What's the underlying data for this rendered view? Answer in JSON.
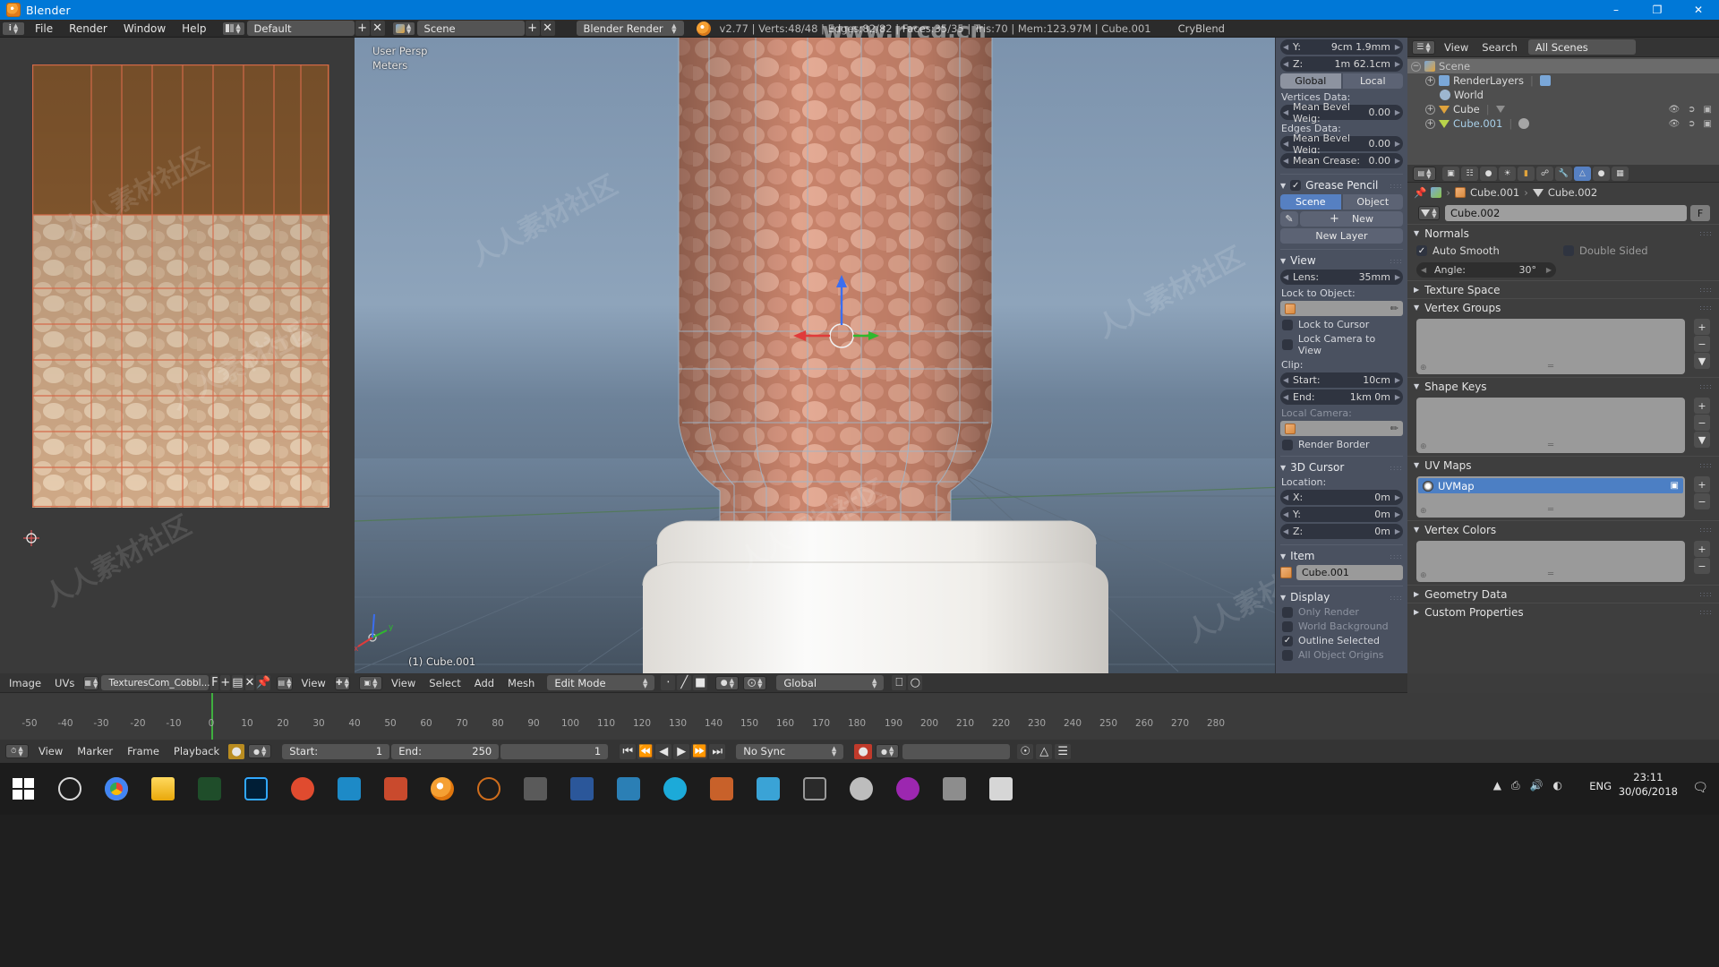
{
  "window": {
    "title": "Blender",
    "app_icon": "blender-logo-icon",
    "minimize": "–",
    "maximize": "❐",
    "close": "✕"
  },
  "topbar": {
    "editor_type_icon": "info-editor-icon",
    "menus": [
      "File",
      "Render",
      "Window",
      "Help"
    ],
    "screen_layout_icon": "screen-layout-icon",
    "screen_layout": "Default",
    "add_screen": "+",
    "delete_screen": "✕",
    "scene_icon": "scene-icon",
    "scene": "Scene",
    "add_scene": "+",
    "delete_scene": "✕",
    "render_engine": "Blender Render",
    "blender_icon": "blender-mark-icon",
    "stats": "v2.77 | Verts:48/48 | Edges:82/82 | Faces:35/35 | Tris:70 | Mem:123.97M | Cube.001",
    "addon": "CryBlend"
  },
  "uv_editor": {
    "header": {
      "editor_type_icon": "uv-image-editor-icon",
      "menus": [
        "Image",
        "UVs"
      ],
      "mode_icon": "view-mode-icon",
      "image_name": "TexturesCom_Cobbl...",
      "fake_user": "F",
      "add_new": "+",
      "unlink": "✕",
      "pin_icon": "pin-icon",
      "view_menu": "View",
      "pivot_icon": "pivot-icon"
    },
    "image_alt": "cobblestone-texture-uv-layout"
  },
  "viewport": {
    "overlay": {
      "view_name": "User Persp",
      "unit": "Meters",
      "object_label": "(1) Cube.001"
    },
    "header": {
      "editor_type_icon": "3d-view-icon",
      "menus": [
        "View",
        "Select",
        "Add",
        "Mesh"
      ],
      "mode": "Edit Mode",
      "mode_icon": "edit-mode-icon",
      "select_modes": [
        "vertex-select-icon",
        "edge-select-icon",
        "face-select-icon"
      ],
      "viewport_shading_icon": "solid-shading-icon",
      "pivot_icon": "pivot-median-icon",
      "transform_orientation": "Global",
      "snap_icon": "snap-magnet-icon",
      "proportional_icon": "proportional-edit-icon"
    }
  },
  "npanel": {
    "transform": {
      "y_label": "Y:",
      "y_value": "9cm 1.9mm",
      "z_label": "Z:",
      "z_value": "1m 62.1cm",
      "global_btn": "Global",
      "local_btn": "Local",
      "vertices_data_label": "Vertices Data:",
      "vertex_bevel_label": "Mean Bevel Weig:",
      "vertex_bevel_value": "0.00",
      "edges_data_label": "Edges Data:",
      "edge_bevel_label": "Mean Bevel Weig:",
      "edge_bevel_value": "0.00",
      "crease_label": "Mean Crease:",
      "crease_value": "0.00"
    },
    "grease_pencil": {
      "title": "Grease Pencil",
      "checked": true,
      "scene_btn": "Scene",
      "object_btn": "Object",
      "new_btn": "New",
      "new_layer_btn": "New Layer",
      "pencil_icon": "pencil-icon",
      "plus_icon": "plus-icon"
    },
    "view": {
      "title": "View",
      "lens_label": "Lens:",
      "lens_value": "35mm",
      "lock_object_label": "Lock to Object:",
      "lock_object_value": "",
      "lock_cursor": "Lock to Cursor",
      "lock_camera": "Lock Camera to View",
      "clip_label": "Clip:",
      "clip_start_label": "Start:",
      "clip_start_value": "10cm",
      "clip_end_label": "End:",
      "clip_end_value": "1km 0m",
      "local_camera_label": "Local Camera:",
      "local_camera_value": "",
      "render_border": "Render Border",
      "eyedropper_icon": "eyedropper-icon",
      "cube_icon": "object-cube-icon"
    },
    "cursor3d": {
      "title": "3D Cursor",
      "location_label": "Location:",
      "x_label": "X:",
      "x_value": "0m",
      "y_label": "Y:",
      "y_value": "0m",
      "z_label": "Z:",
      "z_value": "0m"
    },
    "item": {
      "title": "Item",
      "object_name": "Cube.001",
      "cube_icon": "object-cube-icon"
    },
    "display": {
      "title": "Display",
      "options": [
        {
          "label": "Only Render",
          "checked": false,
          "dim": true
        },
        {
          "label": "World Background",
          "checked": false,
          "dim": true
        },
        {
          "label": "Outline Selected",
          "checked": true,
          "dim": false
        },
        {
          "label": "All Object Origins",
          "checked": false,
          "dim": true
        }
      ]
    }
  },
  "outliner": {
    "header": {
      "editor_type_icon": "outliner-icon",
      "view_menu": "View",
      "search_menu": "Search",
      "display_mode": "All Scenes"
    },
    "rows": [
      {
        "label": "Scene",
        "icon": "scene-icon",
        "indent": 0,
        "selected": true,
        "expander": "−",
        "restrict": []
      },
      {
        "label": "RenderLayers",
        "icon": "renderlayers-icon",
        "indent": 1,
        "selected": false,
        "expander": "+",
        "restrict": []
      },
      {
        "label": "World",
        "icon": "world-icon",
        "indent": 1,
        "selected": false,
        "expander": "",
        "restrict": []
      },
      {
        "label": "Cube",
        "icon": "mesh-triangle-icon",
        "indent": 1,
        "selected": false,
        "expander": "+",
        "restrict": [
          "eye-icon",
          "cursor-icon",
          "camera-icon"
        ]
      },
      {
        "label": "Cube.001",
        "icon": "mesh-triangle-icon-green",
        "indent": 1,
        "selected": false,
        "expander": "+",
        "restrict": [
          "eye-icon",
          "cursor-icon",
          "camera-icon"
        ]
      }
    ]
  },
  "properties": {
    "tabs": [
      "render-tab-icon",
      "renderlayers-tab-icon",
      "scene-tab-icon",
      "world-tab-icon",
      "object-tab-icon",
      "constraints-tab-icon",
      "modifiers-tab-icon",
      "object-data-tab-icon",
      "material-tab-icon",
      "texture-tab-icon"
    ],
    "active_tab_index": 7,
    "editor_type_icon": "properties-editor-icon",
    "pin_icon": "pin-icon",
    "breadcrumb": [
      "Cube.001",
      "Cube.002"
    ],
    "datablock_name": "Cube.002",
    "fake_user": "F",
    "sections": {
      "normals": {
        "title": "Normals",
        "auto_smooth": {
          "label": "Auto Smooth",
          "checked": true
        },
        "double_sided": {
          "label": "Double Sided",
          "checked": false
        },
        "angle_label": "Angle:",
        "angle_value": "30°"
      },
      "texture_space": {
        "title": "Texture Space",
        "open": false
      },
      "vertex_groups": {
        "title": "Vertex Groups",
        "open": true,
        "items": []
      },
      "shape_keys": {
        "title": "Shape Keys",
        "open": true,
        "items": []
      },
      "uv_maps": {
        "title": "UV Maps",
        "open": true,
        "items": [
          {
            "label": "UVMap",
            "selected": true,
            "icon": "uvmap-icon",
            "camera_icon": "camera-icon"
          }
        ]
      },
      "vertex_colors": {
        "title": "Vertex Colors",
        "open": true,
        "items": []
      },
      "geometry_data": {
        "title": "Geometry Data",
        "open": false
      },
      "custom_properties": {
        "title": "Custom Properties",
        "open": false
      }
    },
    "list_buttons": [
      "+",
      "−",
      "▼"
    ]
  },
  "timeline": {
    "header": {
      "editor_type_icon": "timeline-icon",
      "menus": [
        "View",
        "Marker",
        "Frame",
        "Playback"
      ],
      "record_icon": "record-icon",
      "keying_icon": "keying-set-icon",
      "start_label": "Start:",
      "start_value": "1",
      "end_label": "End:",
      "end_value": "250",
      "current_frame": "1",
      "jump_start_icon": "jump-to-start-icon",
      "prev_key_icon": "prev-keyframe-icon",
      "play_reverse_icon": "play-reverse-icon",
      "play_icon": "play-icon",
      "next_key_icon": "next-keyframe-icon",
      "jump_end_icon": "jump-to-end-icon",
      "sync_mode": "No Sync",
      "autokey_icon": "auto-keyframe-icon",
      "ghost_icon": "onion-skin-icon",
      "only_selected_icon": "only-selected-icon",
      "summary_icon": "summary-icon"
    },
    "tick_labels": [
      "-50",
      "-40",
      "-30",
      "-20",
      "-10",
      "0",
      "10",
      "20",
      "30",
      "40",
      "50",
      "60",
      "70",
      "80",
      "90",
      "100",
      "110",
      "120",
      "130",
      "140",
      "150",
      "160",
      "170",
      "180",
      "190",
      "200",
      "210",
      "220",
      "230",
      "240",
      "250",
      "260",
      "270",
      "280"
    ],
    "playhead_frame": "1"
  },
  "taskbar": {
    "start_icon": "windows-start-icon",
    "apps": [
      {
        "name": "cortana-search-icon",
        "color": "#d9d9d9"
      },
      {
        "name": "chrome-icon",
        "color": "#4285f4"
      },
      {
        "name": "file-explorer-icon",
        "color": "#ffb900"
      },
      {
        "name": "marvelous-designer-icon",
        "color": "#2e7d32"
      },
      {
        "name": "photoshop-icon",
        "color": "#001e36"
      },
      {
        "name": "quixel-icon",
        "color": "#e04b2f"
      },
      {
        "name": "substance-painter-icon",
        "color": "#1d8ac7"
      },
      {
        "name": "zbrush-icon",
        "color": "#c94a2d"
      },
      {
        "name": "blender-icon",
        "color": "#e87d0d"
      },
      {
        "name": "unreal-engine-icon",
        "color": "#cf6d1c"
      },
      {
        "name": "notepad-icon",
        "color": "#4a4a4a"
      },
      {
        "name": "word-icon",
        "color": "#2b579a"
      },
      {
        "name": "3dsmax-icon",
        "color": "#2b7fb5"
      },
      {
        "name": "sketchfab-icon",
        "color": "#1caad9"
      },
      {
        "name": "substance-designer-icon",
        "color": "#c8612a"
      },
      {
        "name": "crytek-icon",
        "color": "#3aa3d6"
      },
      {
        "name": "epic-games-icon",
        "color": "#2a2a2a"
      },
      {
        "name": "unity-icon",
        "color": "#bdbdbd"
      },
      {
        "name": "mixamo-icon",
        "color": "#9c27b0"
      },
      {
        "name": "image-viewer-icon",
        "color": "#8d8d8d"
      },
      {
        "name": "terminal-icon",
        "color": "#d6d6d6"
      }
    ],
    "systray": [
      "show-hidden-icon",
      "printer-icon",
      "volume-icon",
      "network-icon"
    ],
    "language": "ENG",
    "time": "23:11",
    "date": "30/06/2018",
    "notification_icon": "action-center-icon"
  },
  "watermarks": {
    "top": "www.rrcg.cn",
    "body": "人人素材社区"
  },
  "colors": {
    "accent_blue": "#5680c2",
    "title_blue": "#0078d7",
    "panel_bg": "#3e3e3e",
    "npanel_bg": "#4a5160",
    "green_playhead": "#3fae3f"
  }
}
